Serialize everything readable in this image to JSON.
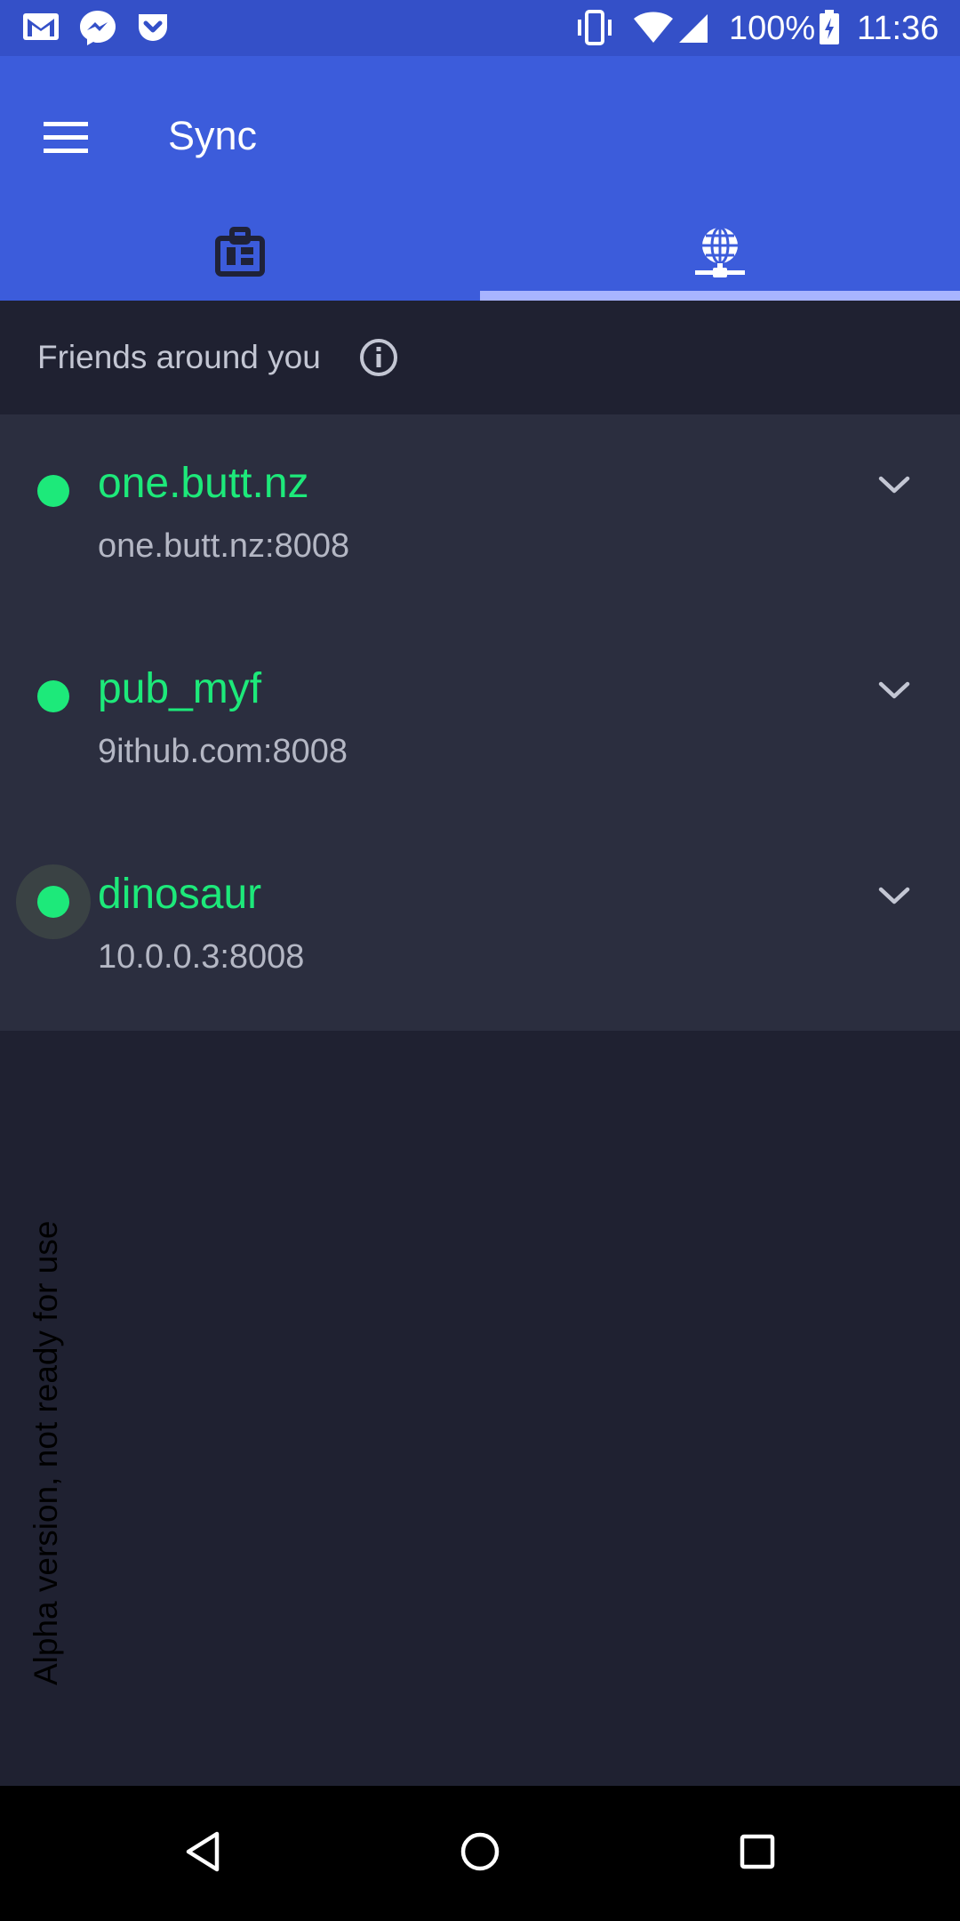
{
  "status_bar": {
    "notifications": [
      "gmail-icon",
      "messenger-icon",
      "pocket-icon"
    ],
    "system_icons": [
      "vibrate-icon",
      "wifi-icon",
      "signal-icon"
    ],
    "battery_percent": "100%",
    "battery_icon": "battery-charging-icon",
    "time": "11:36"
  },
  "app_bar": {
    "title": "Sync",
    "menu_icon": "hamburger-menu-icon",
    "tabs": [
      {
        "icon": "dashboard-icon",
        "selected": false
      },
      {
        "icon": "network-globe-icon",
        "selected": true
      }
    ]
  },
  "section": {
    "title": "Friends around you",
    "info_icon": "info-icon"
  },
  "peers": [
    {
      "name": "one.butt.nz",
      "address": "one.butt.nz:8008",
      "status": "online"
    },
    {
      "name": "pub_myf",
      "address": "9ithub.com:8008",
      "status": "online"
    },
    {
      "name": "dinosaur",
      "address": "10.0.0.3:8008",
      "status": "online"
    }
  ],
  "footer_note": "Alpha version, not ready for use",
  "nav_bar": {
    "buttons": [
      "back-icon",
      "home-icon",
      "recents-icon"
    ]
  },
  "colors": {
    "status_bar": "#3450c8",
    "app_bar": "#3c5cdb",
    "tab_indicator": "#a8b4ff",
    "background": "#1f2131",
    "list_background": "#2b2e3f",
    "online": "#1de97a"
  }
}
